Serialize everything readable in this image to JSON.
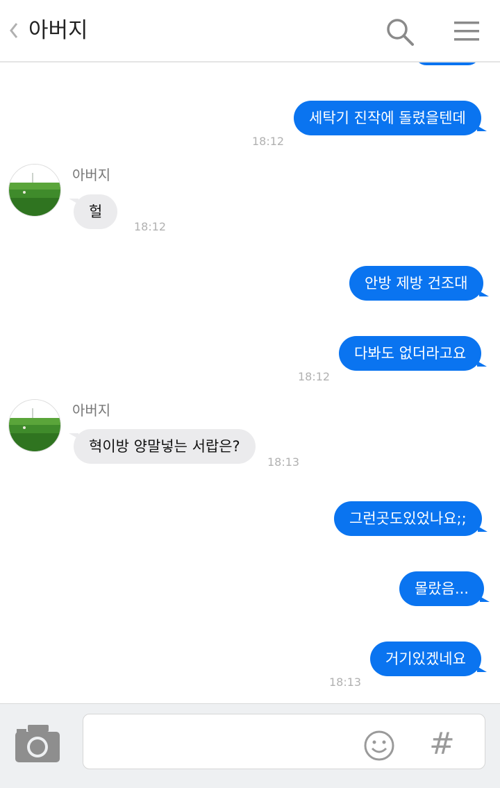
{
  "header": {
    "title": "아버지"
  },
  "messages": [
    {
      "text": "세탁기 진작에 돌렸을텐데",
      "time": "18:12"
    },
    {
      "sender": "아버지",
      "text": "헐",
      "time": "18:12"
    },
    {
      "text": "안방 제방 건조대"
    },
    {
      "text": "다봐도 없더라고요",
      "time": "18:12"
    },
    {
      "sender": "아버지",
      "text": "혁이방 양말넣는 서랍은?",
      "time": "18:13"
    },
    {
      "text": "그런곳도있었나요;;"
    },
    {
      "text": "몰랐음..."
    },
    {
      "text": "거기있겠네요",
      "time": "18:13"
    }
  ],
  "input": {
    "value": "",
    "hash_symbol": "#"
  },
  "colors": {
    "outgoing": "#0a74f0",
    "incoming": "#ebebed",
    "accent": "#0a74f0"
  }
}
